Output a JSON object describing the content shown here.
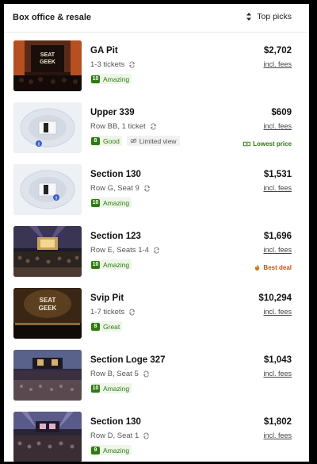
{
  "header": {
    "title": "Box office & resale",
    "sort_label": "Top picks"
  },
  "listings": [
    {
      "section": "GA Pit",
      "detail": "1-3 tickets",
      "deal_score": "10",
      "deal_label": "Amazing",
      "price": "$2,702",
      "fees_label": "incl. fees",
      "thumbnail": "stage-photo",
      "thumb_text": "SEAT GEEK"
    },
    {
      "section": "Upper 339",
      "detail": "Row BB, 1 ticket",
      "deal_score": "8",
      "deal_label": "Good",
      "limited_label": "Limited view",
      "price": "$609",
      "fees_label": "incl. fees",
      "badge": "Lowest price",
      "badge_color": "#2f7a10",
      "badge_icon": "money-icon",
      "thumbnail": "seat-map",
      "thumb_text": "8"
    },
    {
      "section": "Section 130",
      "detail": "Row G, Seat 9",
      "deal_score": "10",
      "deal_label": "Amazing",
      "price": "$1,531",
      "fees_label": "incl. fees",
      "thumbnail": "seat-map",
      "thumb_text": "9"
    },
    {
      "section": "Section 123",
      "detail": "Row E, Seats 1-4",
      "deal_score": "10",
      "deal_label": "Amazing",
      "price": "$1,696",
      "fees_label": "incl. fees",
      "badge": "Best deal",
      "badge_color": "#c9540c",
      "badge_icon": "flame-icon",
      "thumbnail": "stage-photo"
    },
    {
      "section": "Svip Pit",
      "detail": "1-7 tickets",
      "deal_score": "8",
      "deal_label": "Great",
      "price": "$10,294",
      "fees_label": "incl. fees",
      "thumbnail": "stage-photo",
      "thumb_text": "SEAT GEEK"
    },
    {
      "section": "Section Loge 327",
      "detail": "Row B, Seat 5",
      "deal_score": "10",
      "deal_label": "Amazing",
      "price": "$1,043",
      "fees_label": "incl. fees",
      "thumbnail": "stage-photo"
    },
    {
      "section": "Section 130",
      "detail": "Row D, Seat 1",
      "deal_score": "9",
      "deal_label": "Amazing",
      "price": "$1,802",
      "fees_label": "incl. fees",
      "thumbnail": "stage-photo"
    }
  ],
  "colors": {
    "deal_green": "#2f7a10",
    "deal_bg": "#eef6ea",
    "best_deal_orange": "#c9540c",
    "seat_marker": "#3b5fc4"
  }
}
